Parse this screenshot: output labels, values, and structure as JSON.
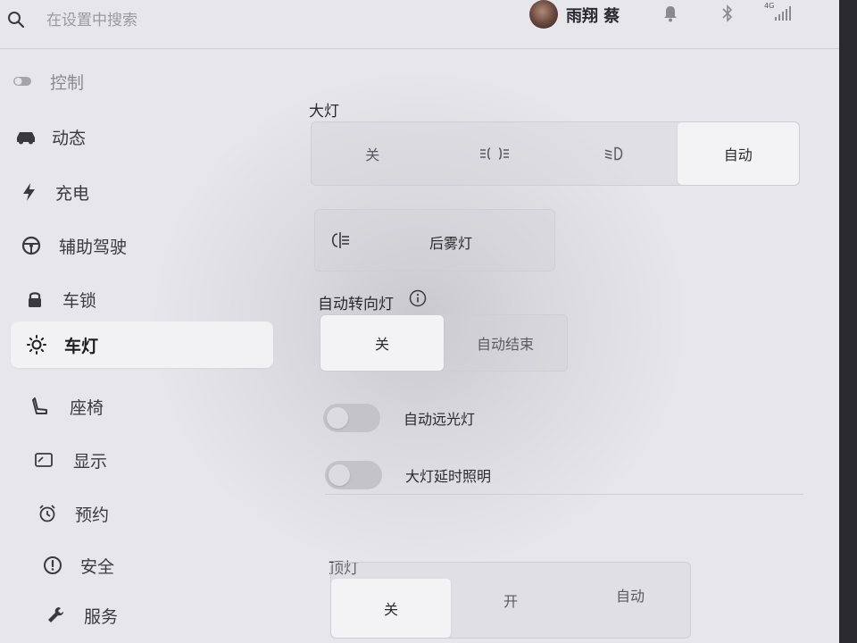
{
  "search": {
    "placeholder": "在设置中搜索"
  },
  "user": {
    "name": "雨翔 蔡"
  },
  "status": {
    "network": "4G"
  },
  "sidebar": {
    "items": [
      {
        "label": "控制",
        "icon": "toggle-icon"
      },
      {
        "label": "动态",
        "icon": "car-icon"
      },
      {
        "label": "充电",
        "icon": "lightning-icon"
      },
      {
        "label": "辅助驾驶",
        "icon": "steering-wheel-icon"
      },
      {
        "label": "车锁",
        "icon": "lock-icon"
      },
      {
        "label": "车灯",
        "icon": "sun-icon",
        "active": true
      },
      {
        "label": "座椅",
        "icon": "seat-icon"
      },
      {
        "label": "显示",
        "icon": "display-icon"
      },
      {
        "label": "预约",
        "icon": "alarm-clock-icon"
      },
      {
        "label": "安全",
        "icon": "alert-circle-icon"
      },
      {
        "label": "服务",
        "icon": "wrench-icon"
      }
    ]
  },
  "headlights": {
    "title": "大灯",
    "options": [
      "关",
      "",
      "",
      "自动"
    ],
    "option_icons": [
      "",
      "parking-lights-icon",
      "low-beam-icon",
      ""
    ],
    "selected": 3
  },
  "rear_fog": {
    "label": "后雾灯",
    "icon": "rear-fog-icon"
  },
  "auto_turn": {
    "title": "自动转向灯",
    "options": [
      "关",
      "自动结束"
    ],
    "selected": 0
  },
  "toggles": {
    "auto_high_beam": {
      "label": "自动远光灯",
      "on": false
    },
    "headlight_delay": {
      "label": "大灯延时照明",
      "on": false
    }
  },
  "dome_light": {
    "title": "顶灯",
    "options": [
      "关",
      "开",
      "自动"
    ],
    "selected": 0
  }
}
